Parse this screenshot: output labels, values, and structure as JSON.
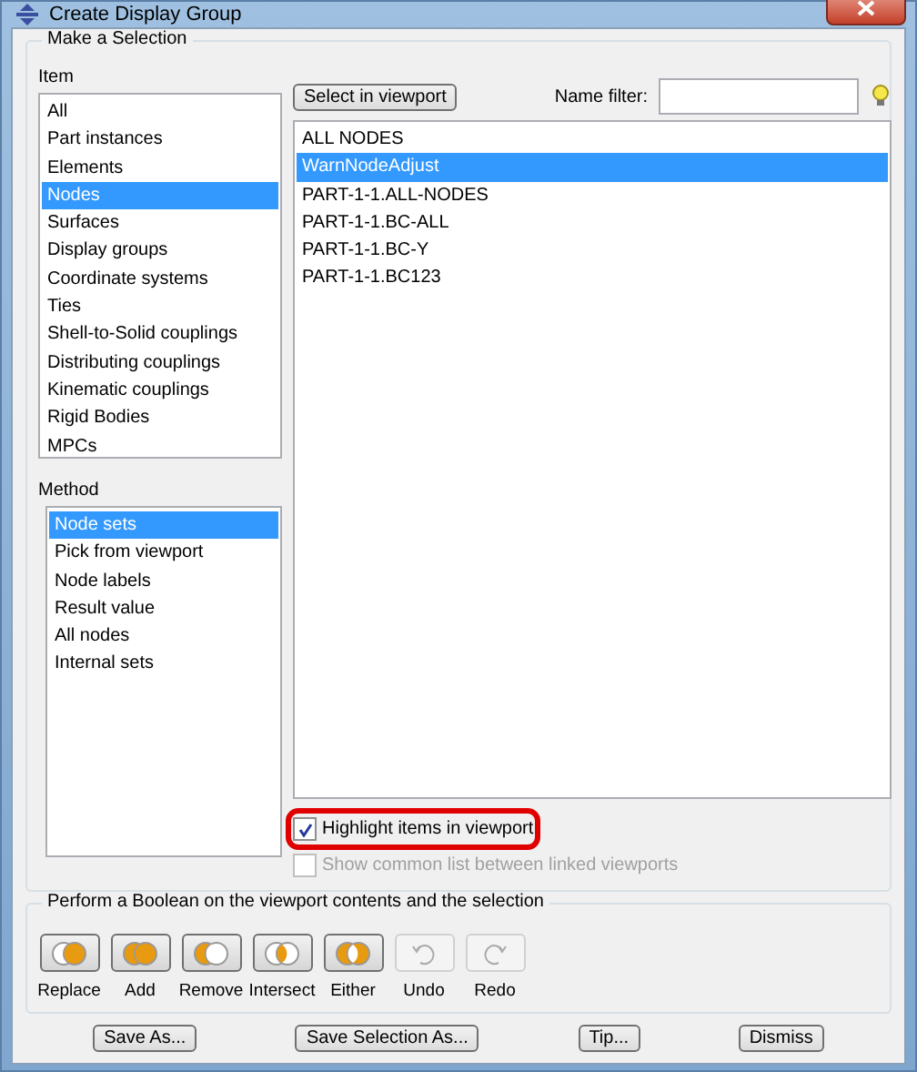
{
  "window": {
    "title": "Create Display Group"
  },
  "selection_group": {
    "title": "Make a Selection"
  },
  "item": {
    "label": "Item",
    "items": [
      {
        "label": "All",
        "selected": false
      },
      {
        "label": "Part instances",
        "selected": false
      },
      {
        "label": "Elements",
        "selected": false
      },
      {
        "label": "Nodes",
        "selected": true
      },
      {
        "label": "Surfaces",
        "selected": false
      },
      {
        "label": "Display groups",
        "selected": false
      },
      {
        "label": "Coordinate systems",
        "selected": false
      },
      {
        "label": "Ties",
        "selected": false
      },
      {
        "label": "Shell-to-Solid couplings",
        "selected": false
      },
      {
        "label": "Distributing couplings",
        "selected": false
      },
      {
        "label": "Kinematic couplings",
        "selected": false
      },
      {
        "label": "Rigid Bodies",
        "selected": false
      },
      {
        "label": "MPCs",
        "selected": false
      }
    ]
  },
  "method": {
    "label": "Method",
    "items": [
      {
        "label": "Node sets",
        "selected": true
      },
      {
        "label": "Pick from viewport",
        "selected": false
      },
      {
        "label": "Node labels",
        "selected": false
      },
      {
        "label": "Result value",
        "selected": false
      },
      {
        "label": "All nodes",
        "selected": false
      },
      {
        "label": "Internal sets",
        "selected": false
      }
    ]
  },
  "select_button": "Select in viewport",
  "name_filter": {
    "label": "Name filter:"
  },
  "sets": [
    {
      "label": "ALL NODES",
      "selected": false
    },
    {
      "label": "WarnNodeAdjust",
      "selected": true
    },
    {
      "label": "PART-1-1.ALL-NODES",
      "selected": false
    },
    {
      "label": "PART-1-1.BC-ALL",
      "selected": false
    },
    {
      "label": "PART-1-1.BC-Y",
      "selected": false
    },
    {
      "label": "PART-1-1.BC123",
      "selected": false
    }
  ],
  "options": [
    {
      "label": "Highlight items in viewport",
      "checked": true,
      "disabled": false,
      "annotated": true
    },
    {
      "label": "Show common list between linked viewports",
      "checked": false,
      "disabled": true,
      "annotated": false
    }
  ],
  "boolean_group": {
    "title": "Perform a Boolean on the viewport contents and the selection",
    "operations": [
      {
        "label": "Replace",
        "kind": "replace",
        "disabled": false
      },
      {
        "label": "Add",
        "kind": "add",
        "disabled": false
      },
      {
        "label": "Remove",
        "kind": "remove",
        "disabled": false
      },
      {
        "label": "Intersect",
        "kind": "intersect",
        "disabled": false
      },
      {
        "label": "Either",
        "kind": "either",
        "disabled": false
      },
      {
        "label": "Undo",
        "kind": "undo",
        "disabled": true
      },
      {
        "label": "Redo",
        "kind": "redo",
        "disabled": true
      }
    ]
  },
  "buttons": [
    "Save As...",
    "Save Selection As...",
    "Tip...",
    "Dismiss"
  ]
}
